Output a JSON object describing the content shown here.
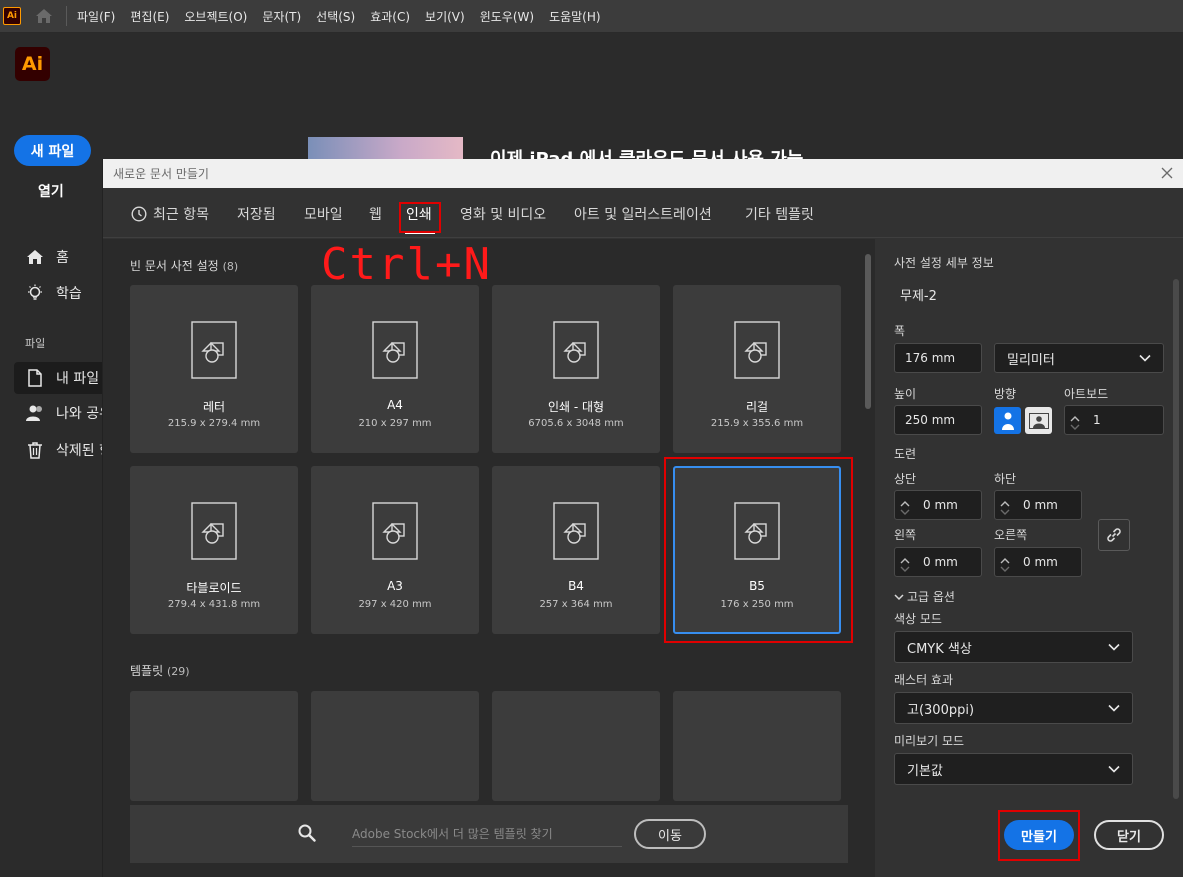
{
  "menubar": {
    "items": [
      "파일(F)",
      "편집(E)",
      "오브젝트(O)",
      "문자(T)",
      "선택(S)",
      "효과(C)",
      "보기(V)",
      "윈도우(W)",
      "도움말(H)"
    ]
  },
  "app": {
    "logo": "Ai",
    "mini_logo": "Ai"
  },
  "home": {
    "new_file": "새 파일",
    "open": "열기",
    "nav": {
      "home": "홈",
      "learn": "학습"
    },
    "section": "파일",
    "files": {
      "my_files": "내 파일",
      "shared": "나와 공유",
      "deleted": "삭제된 항"
    },
    "banner": "이제 iPad 에서 클라우드 문서 사용 가능"
  },
  "dialog": {
    "title": "새로운 문서 만들기",
    "tabs": [
      "최근 항목",
      "저장됨",
      "모바일",
      "웹",
      "인쇄",
      "영화 및 비디오",
      "아트 및 일러스트레이션",
      "기타 템플릿"
    ],
    "active_tab": "인쇄",
    "annotation": "Ctrl+N",
    "presets_label": "빈 문서 사전 설정",
    "presets_count": "(8)",
    "presets": [
      {
        "name": "레터",
        "size": "215.9 x 279.4 mm"
      },
      {
        "name": "A4",
        "size": "210 x 297 mm"
      },
      {
        "name": "인쇄 - 대형",
        "size": "6705.6 x 3048 mm"
      },
      {
        "name": "리걸",
        "size": "215.9 x 355.6 mm"
      },
      {
        "name": "타블로이드",
        "size": "279.4 x 431.8 mm"
      },
      {
        "name": "A3",
        "size": "297 x 420 mm"
      },
      {
        "name": "B4",
        "size": "257 x 364 mm"
      },
      {
        "name": "B5",
        "size": "176 x 250 mm"
      }
    ],
    "selected_preset": "B5",
    "templates_label": "템플릿",
    "templates_count": "(29)",
    "stock": {
      "placeholder": "Adobe Stock에서 더 많은 템플릿 찾기",
      "go": "이동"
    }
  },
  "details": {
    "header": "사전 설정 세부 정보",
    "doc_name": "무제-2",
    "width_label": "폭",
    "width": "176 mm",
    "unit": "밀리미터",
    "height_label": "높이",
    "height": "250 mm",
    "orientation_label": "방향",
    "artboard_label": "아트보드",
    "artboards": "1",
    "bleed_label": "도련",
    "top_label": "상단",
    "top": "0 mm",
    "bottom_label": "하단",
    "bottom": "0 mm",
    "left_label": "왼쪽",
    "left": "0 mm",
    "right_label": "오른쪽",
    "right": "0 mm",
    "advanced_label": "고급 옵션",
    "color_mode_label": "색상 모드",
    "color_mode": "CMYK 색상",
    "raster_label": "래스터 효과",
    "raster": "고(300ppi)",
    "preview_label": "미리보기 모드",
    "preview": "기본값",
    "create": "만들기",
    "close": "닫기"
  },
  "colors": {
    "accent": "#1473e6",
    "selection_border": "#378ef0",
    "annotation_red": "#e00000",
    "ai_orange": "#ff9a00"
  }
}
